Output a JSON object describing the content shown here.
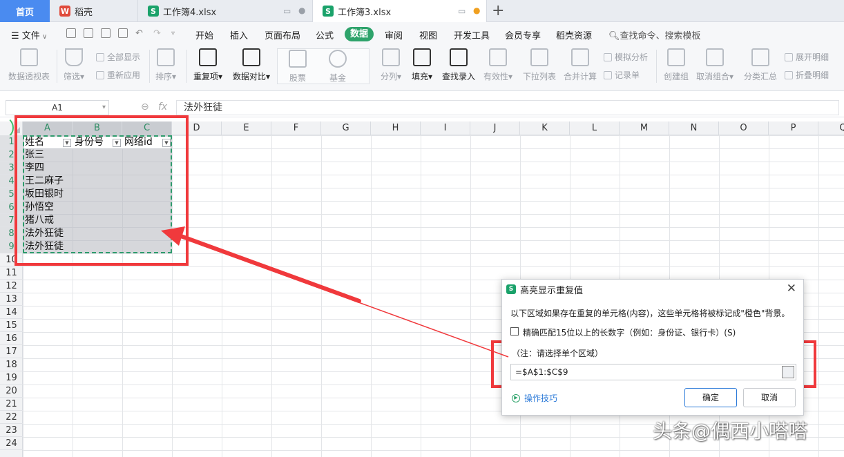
{
  "tabs": {
    "home": "首页",
    "daoke": "稻壳",
    "doc1": "工作簿4.xlsx",
    "doc2": "工作簿3.xlsx"
  },
  "menu": {
    "file": "文件",
    "items": [
      "开始",
      "插入",
      "页面布局",
      "公式",
      "数据",
      "审阅",
      "视图",
      "开发工具",
      "会员专享",
      "稻壳资源"
    ],
    "active": "数据",
    "search": "查找命令、搜索模板"
  },
  "ribbon": {
    "pivot": "数据透视表",
    "filter": "筛选",
    "show_all": "全部显示",
    "reapply": "重新应用",
    "sort": "排序",
    "duplicates": "重复项",
    "compare": "数据对比",
    "stock": "股票",
    "fund": "基金",
    "split": "分列",
    "fill": "填充",
    "lookup": "查找录入",
    "validity": "有效性",
    "dropdown": "下拉列表",
    "consolidate": "合并计算",
    "simulate": "模拟分析",
    "record": "记录单",
    "group": "创建组",
    "ungroup": "取消组合",
    "subtotal": "分类汇总",
    "expand": "展开明细",
    "collapse": "折叠明细"
  },
  "formula_bar": {
    "cell_ref": "A1",
    "fx": "fx",
    "content": "法外狂徒"
  },
  "sheet": {
    "columns": [
      "A",
      "B",
      "C",
      "D",
      "E",
      "F",
      "G",
      "H",
      "I",
      "J",
      "K",
      "L",
      "M",
      "N",
      "O",
      "P",
      "Q"
    ],
    "rows": [
      "1",
      "2",
      "3",
      "4",
      "5",
      "6",
      "7",
      "8",
      "9",
      "10",
      "11",
      "12",
      "13",
      "14",
      "15",
      "16",
      "17",
      "18",
      "19",
      "20",
      "21",
      "22",
      "23",
      "24"
    ],
    "headers": [
      "姓名",
      "身份号",
      "网络id"
    ],
    "names": [
      "张三",
      "李四",
      "王二麻子",
      "坂田银时",
      "孙悟空",
      "猪八戒",
      "法外狂徒",
      "法外狂徒"
    ]
  },
  "dialog": {
    "title": "高亮显示重复值",
    "description": "以下区域如果存在重复的单元格(内容)，这些单元格将被标记成\"橙色\"背景。",
    "checkbox_label": "精确匹配15位以上的长数字（例如：身份证、银行卡）(S)",
    "checkbox_checked": false,
    "note": "（注：请选择单个区域）",
    "range_value": "=$A$1:$C$9",
    "tips": "操作技巧",
    "ok": "确定",
    "cancel": "取消"
  },
  "watermark": "头条@偶西小嗒嗒",
  "colors": {
    "accent": "#2ea36b",
    "annotation": "#f0393c",
    "home_tab": "#4a8bf0"
  }
}
